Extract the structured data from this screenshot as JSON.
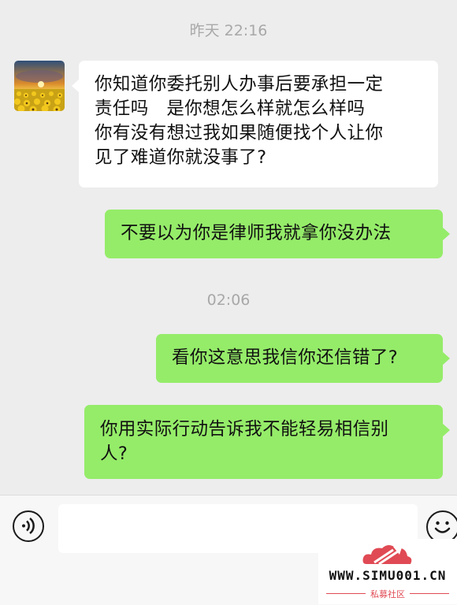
{
  "chat": {
    "timestamp_1": "昨天 22:16",
    "timestamp_2": "02:06",
    "messages": [
      {
        "from": "contact",
        "text": "你知道你委托别人办事后要承担一定\n责任吗   是你想怎么样就怎么样吗\n你有没有想过我如果随便找个人让你\n见了难道你就没事了?"
      },
      {
        "from": "me",
        "text": "不要以为你是律师我就拿你没办法"
      },
      {
        "from": "me",
        "text": "看你这意思我信你还信错了?"
      },
      {
        "from": "me",
        "text": "你用实际行动告诉我不能轻易相信别\n人?"
      }
    ]
  },
  "input_bar": {
    "voice_icon": "voice-icon",
    "emoji_icon": "emoji-icon",
    "text_value": ""
  },
  "watermark": {
    "url": "WWW.SIMU001.CN",
    "subtitle": "私募社区"
  },
  "colors": {
    "background": "#ededed",
    "outgoing_bubble": "#95ec69",
    "incoming_bubble": "#ffffff",
    "timestamp": "#a8a8a8",
    "brand_red": "#e04a54"
  }
}
